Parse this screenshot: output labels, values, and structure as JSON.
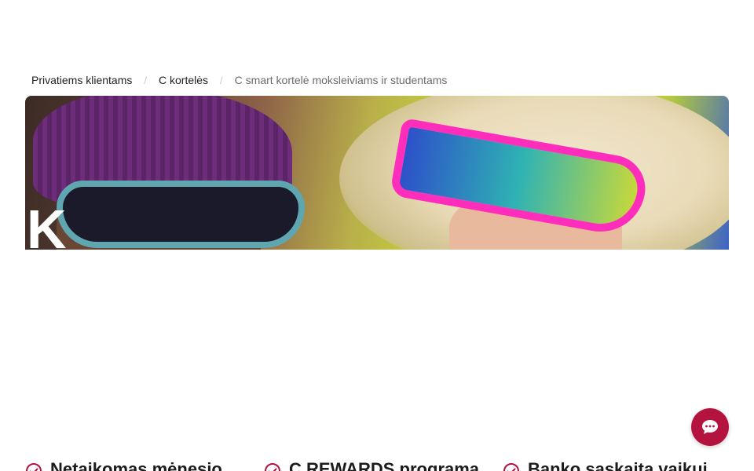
{
  "breadcrumb": {
    "items": [
      "Privatiems klientams",
      "C kortelės"
    ],
    "current": "C smart kortelė moksleiviams ir studentams",
    "separator": "/"
  },
  "hero": {
    "letter": "K"
  },
  "chat": {
    "icon": "chat-bubble-icon",
    "color": "#b4123f"
  },
  "features": [
    {
      "icon": "check-circle-icon",
      "title": "Netaikomas mėnesio"
    },
    {
      "icon": "check-circle-icon",
      "title": "C REWARDS programa"
    },
    {
      "icon": "check-circle-icon",
      "title": "Banko sąskaita vaikui"
    }
  ],
  "colors": {
    "accent": "#b4123f",
    "text": "#1f1f1f",
    "muted": "#6b6b6b"
  }
}
